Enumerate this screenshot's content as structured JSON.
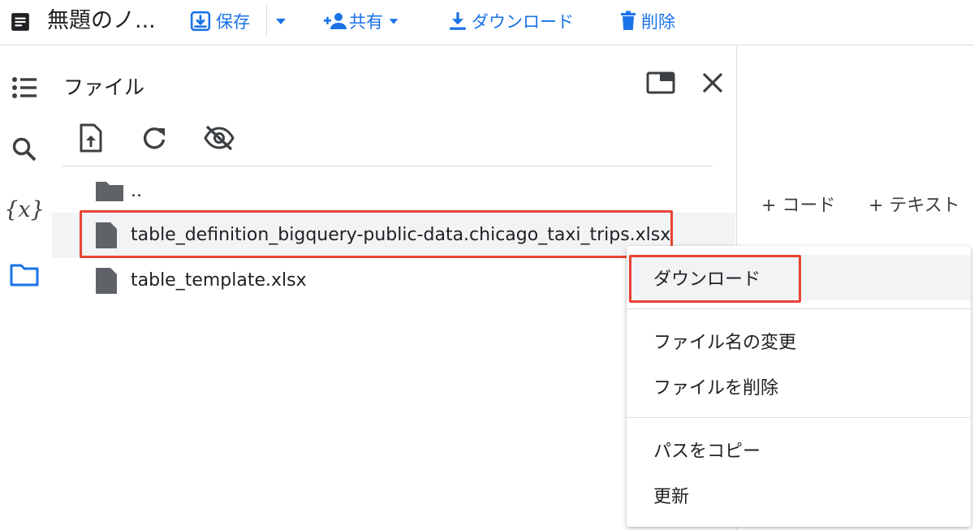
{
  "toolbar": {
    "title": "無題のノ...",
    "save_label": "保存",
    "share_label": "共有",
    "download_label": "ダウンロード",
    "delete_label": "削除"
  },
  "files_panel": {
    "title": "ファイル",
    "parent_dir": "..",
    "items": [
      {
        "name": "table_definition_bigquery-public-data.chicago_taxi_trips.xlsx",
        "selected": true
      },
      {
        "name": "table_template.xlsx",
        "selected": false
      }
    ]
  },
  "notebook": {
    "add_code_label": "+ コード",
    "add_text_label": "+ テキスト"
  },
  "context_menu": {
    "items": [
      {
        "label": "ダウンロード"
      },
      {
        "label": "ファイル名の変更"
      },
      {
        "label": "ファイルを削除"
      },
      {
        "label": "パスをコピー"
      },
      {
        "label": "更新"
      }
    ]
  },
  "colors": {
    "accent": "#1a73e8",
    "highlight": "#ea4335",
    "icon": "#5f6368"
  },
  "icons": [
    "doc-icon",
    "save-icon",
    "person-add-icon",
    "download-icon",
    "trash-icon",
    "toc-icon",
    "search-icon",
    "variables-icon",
    "folder-icon",
    "pip-icon",
    "close-icon",
    "upload-icon",
    "refresh-icon",
    "visibility-off-icon",
    "file-icon"
  ]
}
